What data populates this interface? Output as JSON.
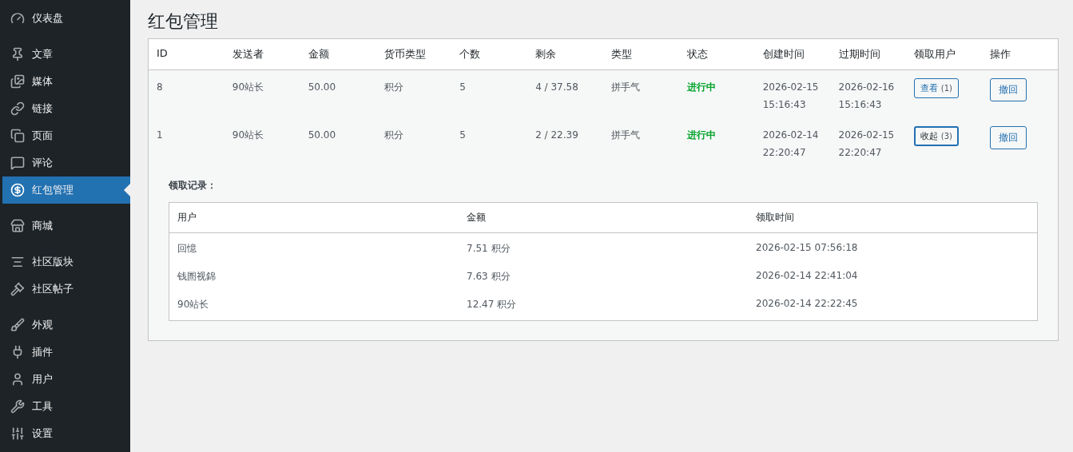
{
  "sidebar": {
    "groups": [
      [
        {
          "label": "仪表盘",
          "selected": false
        }
      ],
      [
        {
          "label": "文章",
          "selected": false
        },
        {
          "label": "媒体",
          "selected": false
        },
        {
          "label": "链接",
          "selected": false
        },
        {
          "label": "页面",
          "selected": false
        },
        {
          "label": "评论",
          "selected": false
        },
        {
          "label": "红包管理",
          "selected": true
        }
      ],
      [
        {
          "label": "商城",
          "selected": false
        }
      ],
      [
        {
          "label": "社区版块",
          "selected": false
        },
        {
          "label": "社区帖子",
          "selected": false
        }
      ],
      [
        {
          "label": "外观",
          "selected": false
        },
        {
          "label": "插件",
          "selected": false
        },
        {
          "label": "用户",
          "selected": false
        },
        {
          "label": "工具",
          "selected": false
        },
        {
          "label": "设置",
          "selected": false
        }
      ]
    ]
  },
  "page_title": "红包管理",
  "table": {
    "columns": [
      "ID",
      "发送者",
      "金额",
      "货币类型",
      "个数",
      "剩余",
      "类型",
      "状态",
      "创建时间",
      "过期时间",
      "领取用户",
      "操作"
    ],
    "rows": [
      {
        "cells": [
          "8",
          "90站长",
          "50.00",
          "积分",
          "5",
          "4 / 37.58",
          "拼手气"
        ],
        "status": "进行中",
        "created": [
          "2026-02-15",
          "15:16:43"
        ],
        "expires": [
          "2026-02-16",
          "15:16:43"
        ],
        "claim_button": {
          "label": "查看",
          "count": "(1)",
          "expanded": false
        },
        "action": "撤回"
      },
      {
        "cells": [
          "1",
          "90站长",
          "50.00",
          "积分",
          "5",
          "2 / 22.39",
          "拼手气"
        ],
        "status": "进行中",
        "created": [
          "2026-02-14",
          "22:20:47"
        ],
        "expires": [
          "2026-02-15",
          "22:20:47"
        ],
        "claim_button": {
          "label": "收起",
          "count": "(3)",
          "expanded": true
        },
        "action": "撤回"
      }
    ]
  },
  "records": {
    "title": "领取记录：",
    "columns": [
      "用户",
      "金额",
      "领取时间"
    ],
    "rows": [
      [
        "回憶",
        "7.51 积分",
        "2026-02-15 07:56:18"
      ],
      [
        "钱圄视錦",
        "7.63 积分",
        "2026-02-14 22:41:04"
      ],
      [
        "90站长",
        "12.47 积分",
        "2026-02-14 22:22:45"
      ]
    ]
  }
}
